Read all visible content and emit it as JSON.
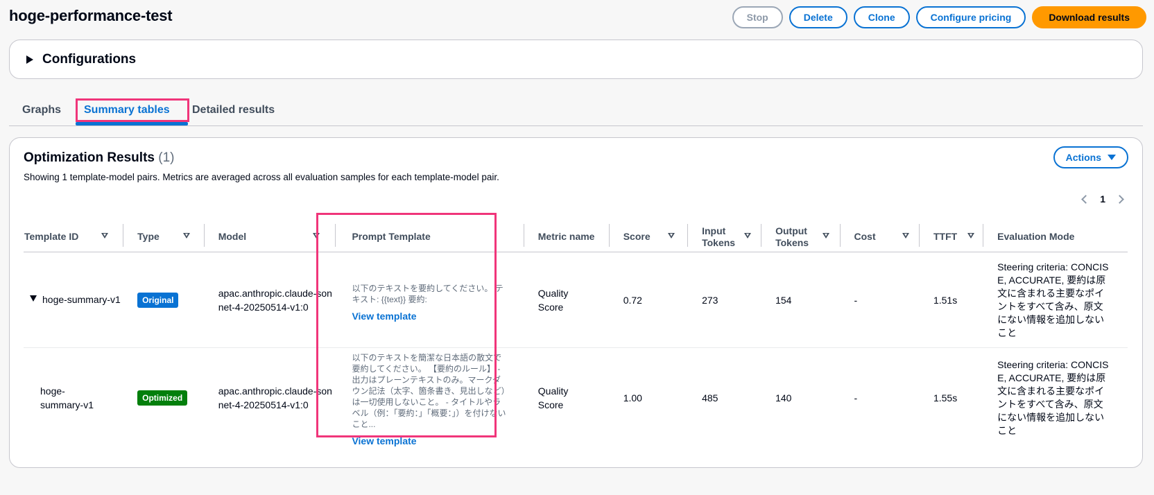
{
  "page": {
    "title": "hoge-performance-test",
    "buttons": {
      "stop": "Stop",
      "delete": "Delete",
      "clone": "Clone",
      "configure_pricing": "Configure pricing",
      "download_results": "Download results"
    }
  },
  "configurations": {
    "title": "Configurations"
  },
  "tabs": [
    {
      "label": "Graphs"
    },
    {
      "label": "Summary tables"
    },
    {
      "label": "Detailed results"
    }
  ],
  "panel": {
    "title": "Optimization Results",
    "count": "(1)",
    "description": "Showing 1 template-model pairs. Metrics are averaged across all evaluation samples for each template-model pair.",
    "actions_label": "Actions",
    "page_number": "1"
  },
  "table": {
    "headers": {
      "template_id": "Template ID",
      "type": "Type",
      "model": "Model",
      "prompt_template": "Prompt Template",
      "metric_name": "Metric name",
      "score": "Score",
      "input_tokens": "Input Tokens",
      "output_tokens": "Output Tokens",
      "cost": "Cost",
      "ttft": "TTFT",
      "evaluation_mode": "Evaluation Mode"
    },
    "rows": [
      {
        "template_id": "hoge-summary-v1",
        "type": "Original",
        "model": "apac.anthropic.claude-sonnet-4-20250514-v1:0",
        "prompt": "以下のテキストを要約してください。 テキスト: {{text}} 要約:",
        "view_template": "View template",
        "metric_name": "Quality Score",
        "score": "0.72",
        "input_tokens": "273",
        "output_tokens": "154",
        "cost": "-",
        "ttft": "1.51s",
        "evaluation_mode": "Steering criteria: CONCISE, ACCURATE, 要約は原文に含まれる主要なポイントをすべて含み、原文にない情報を追加しないこと"
      },
      {
        "template_id": "hoge-summary-v1",
        "type": "Optimized",
        "model": "apac.anthropic.claude-sonnet-4-20250514-v1:0",
        "prompt": "以下のテキストを簡潔な日本語の散文で要約してください。 【要約のルール】 - 出力はプレーンテキストのみ。マークダウン記法（太字、箇条書き、見出しなど）は一切使用しないこと。 - タイトルやラベル（例：「要約：」「概要：」）を付けないこと...",
        "view_template": "View template",
        "metric_name": "Quality Score",
        "score": "1.00",
        "input_tokens": "485",
        "output_tokens": "140",
        "cost": "-",
        "ttft": "1.55s",
        "evaluation_mode": "Steering criteria: CONCISE, ACCURATE, 要約は原文に含まれる主要なポイントをすべて含み、原文にない情報を追加しないこと"
      }
    ]
  },
  "colors": {
    "accent": "#0972d3",
    "primary_button": "#ff9900",
    "highlight": "#f0357a",
    "badge_original": "#0972d3",
    "badge_optimized": "#037f0c"
  }
}
